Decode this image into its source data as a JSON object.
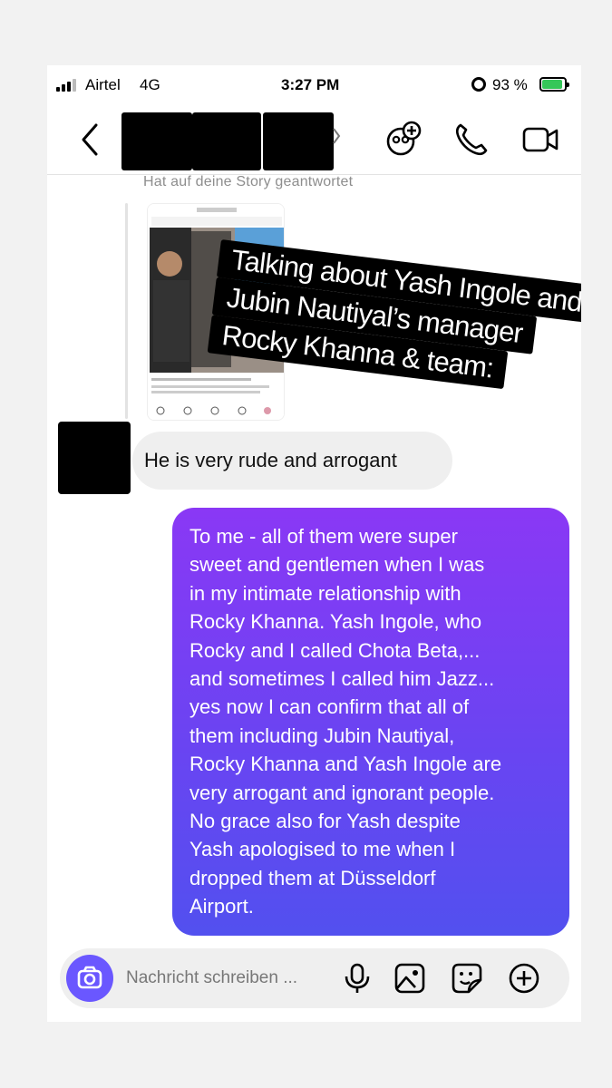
{
  "status_bar": {
    "carrier": "Airtel",
    "network": "4G",
    "time": "3:27 PM",
    "battery_percent": "93 %",
    "battery_level": 0.93
  },
  "header": {
    "contact_name": "",
    "icons": [
      "back-chevron-icon",
      "add-people-icon",
      "phone-icon",
      "video-camera-icon"
    ]
  },
  "story_reply": {
    "caption": "Hat auf deine Story geantwortet"
  },
  "overlay_caption": [
    "Talking about Yash Ingole and",
    "Jubin Nautiyal’s manager",
    "Rocky Khanna & team:"
  ],
  "messages": [
    {
      "direction": "received",
      "text": "He is very rude and arrogant"
    },
    {
      "direction": "sent",
      "lines": [
        "To me - all of them were super",
        "sweet and gentlemen when I was",
        "in my intimate relationship with",
        "Rocky Khanna. Yash Ingole, who",
        "Rocky and I called Chota Beta,...",
        "and sometimes I called him Jazz...",
        "yes now I can confirm that all of",
        "them including Jubin Nautiyal,",
        "Rocky Khanna and Yash Ingole are",
        "very arrogant and ignorant people.",
        "No grace also for Yash despite",
        "Yash apologised to me when I",
        "dropped them at Düsseldorf",
        "Airport."
      ]
    }
  ],
  "composer": {
    "placeholder": "Nachricht schreiben ...",
    "icons": [
      "camera-icon",
      "microphone-icon",
      "gallery-icon",
      "sticker-icon",
      "plus-icon"
    ]
  },
  "colors": {
    "sent_bubble_top": "#8a38f5",
    "sent_bubble_bottom": "#5250ef",
    "received_bubble": "#efefef",
    "camera_button": "#6a57ff",
    "battery_fill": "#35c759"
  }
}
